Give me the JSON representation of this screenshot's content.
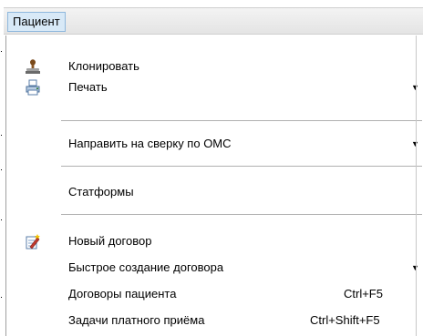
{
  "menubar": {
    "active_menu": "Пациент"
  },
  "menu": {
    "items": [
      {
        "label": "Клонировать",
        "icon": "stamp-icon",
        "submenu": false
      },
      {
        "label": "Печать",
        "icon": "printer-icon",
        "submenu": true
      },
      {
        "label": "Направить на сверку по ОМС",
        "submenu": true
      },
      {
        "label": "Статформы",
        "submenu": false
      },
      {
        "label": "Новый договор",
        "icon": "new-document-icon",
        "submenu": false
      },
      {
        "label": "Быстрое создание договора",
        "submenu": true
      },
      {
        "label": "Договоры пациента",
        "shortcut": "Ctrl+F5"
      },
      {
        "label": "Задачи платного приёма",
        "shortcut": "Ctrl+Shift+F5"
      }
    ]
  }
}
